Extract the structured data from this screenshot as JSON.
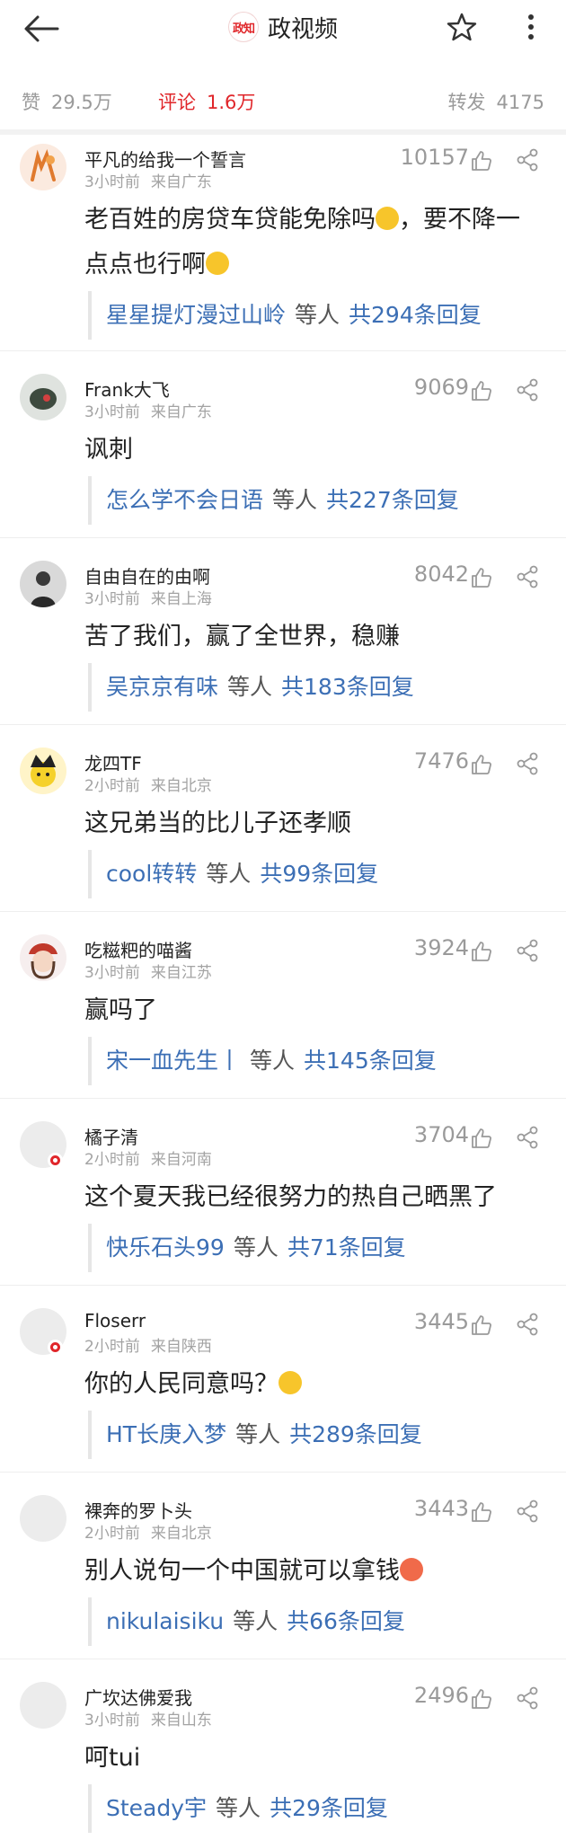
{
  "header": {
    "title": "政视频",
    "logo_text": "政知"
  },
  "stats": {
    "like_label": "赞",
    "like_value": "29.5万",
    "comment_label": "评论",
    "comment_value": "1.6万",
    "repost_label": "转发",
    "repost_value": "4175"
  },
  "colors": {
    "accent": "#e0262a",
    "link": "#3c6fb5"
  },
  "comments": [
    {
      "user": "平凡的给我一个誓言",
      "time": "3小时前",
      "loc": "来自广东",
      "likes": "10157",
      "text_a": "老百姓的房贷车贷能免除吗",
      "text_b": "，要不降一点点也行啊",
      "reply_user": "星星提灯漫过山岭",
      "reply_etc": "等人",
      "reply_count": "共294条回复"
    },
    {
      "user": "Frank大飞",
      "time": "3小时前",
      "loc": "来自广东",
      "likes": "9069",
      "text": "讽刺",
      "reply_user": "怎么学不会日语",
      "reply_etc": "等人",
      "reply_count": "共227条回复"
    },
    {
      "user": "自由自在的由啊",
      "time": "3小时前",
      "loc": "来自上海",
      "likes": "8042",
      "text": "苦了我们，赢了全世界，稳赚",
      "reply_user": "吴京京有味",
      "reply_etc": "等人",
      "reply_count": "共183条回复"
    },
    {
      "user": "龙四TF",
      "time": "2小时前",
      "loc": "来自北京",
      "likes": "7476",
      "text": "这兄弟当的比儿子还孝顺",
      "reply_user": "cool转转",
      "reply_etc": "等人",
      "reply_count": "共99条回复"
    },
    {
      "user": "吃糍粑的喵酱",
      "time": "3小时前",
      "loc": "来自江苏",
      "likes": "3924",
      "text": "赢吗了",
      "reply_user": "宋一血先生丨",
      "reply_etc": "等人",
      "reply_count": "共145条回复"
    },
    {
      "user": "橘子清",
      "time": "2小时前",
      "loc": "来自河南",
      "likes": "3704",
      "text": "这个夏天我已经很努力的热自己晒黑了",
      "reply_user": "快乐石头99",
      "reply_etc": "等人",
      "reply_count": "共71条回复"
    },
    {
      "user": "Floserr",
      "time": "2小时前",
      "loc": "来自陕西",
      "likes": "3445",
      "text": "你的人民同意吗？",
      "reply_user": "HT长庚入梦",
      "reply_etc": "等人",
      "reply_count": "共289条回复"
    },
    {
      "user": "裸奔的罗卜头",
      "time": "2小时前",
      "loc": "来自北京",
      "likes": "3443",
      "text": "别人说句一个中国就可以拿钱",
      "reply_user": "nikulaisiku",
      "reply_etc": "等人",
      "reply_count": "共66条回复"
    },
    {
      "user": "广坎达佛爱我",
      "time": "3小时前",
      "loc": "来自山东",
      "likes": "2496",
      "text": "呵tui",
      "reply_user": "Steady宇",
      "reply_etc": "等人",
      "reply_count": "共29条回复"
    }
  ]
}
